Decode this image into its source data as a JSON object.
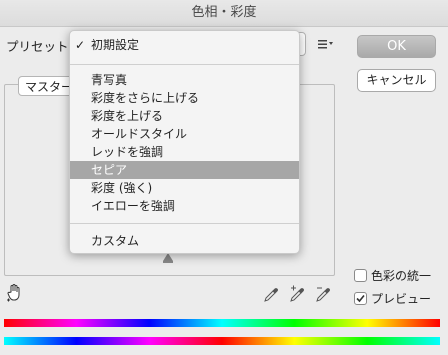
{
  "window": {
    "title": "色相・彩度"
  },
  "preset": {
    "label": "プリセット："
  },
  "buttons": {
    "ok": "OK",
    "cancel": "キャンセル"
  },
  "channel": {
    "value": "マスター"
  },
  "menu": {
    "checked_item": "初期設定",
    "items": [
      "青写真",
      "彩度をさらに上げる",
      "彩度を上げる",
      "オールドスタイル",
      "レッドを強調",
      "セピア",
      "彩度 (強く)",
      "イエローを強調"
    ],
    "selected_index": 5,
    "custom_item": "カスタム"
  },
  "options": {
    "colorize_label": "色彩の統一",
    "colorize_checked": false,
    "preview_label": "プレビュー",
    "preview_checked": true
  },
  "colors": {
    "ok_bg": "#b0b0b0",
    "menu_highlight": "#a6a6a6"
  }
}
